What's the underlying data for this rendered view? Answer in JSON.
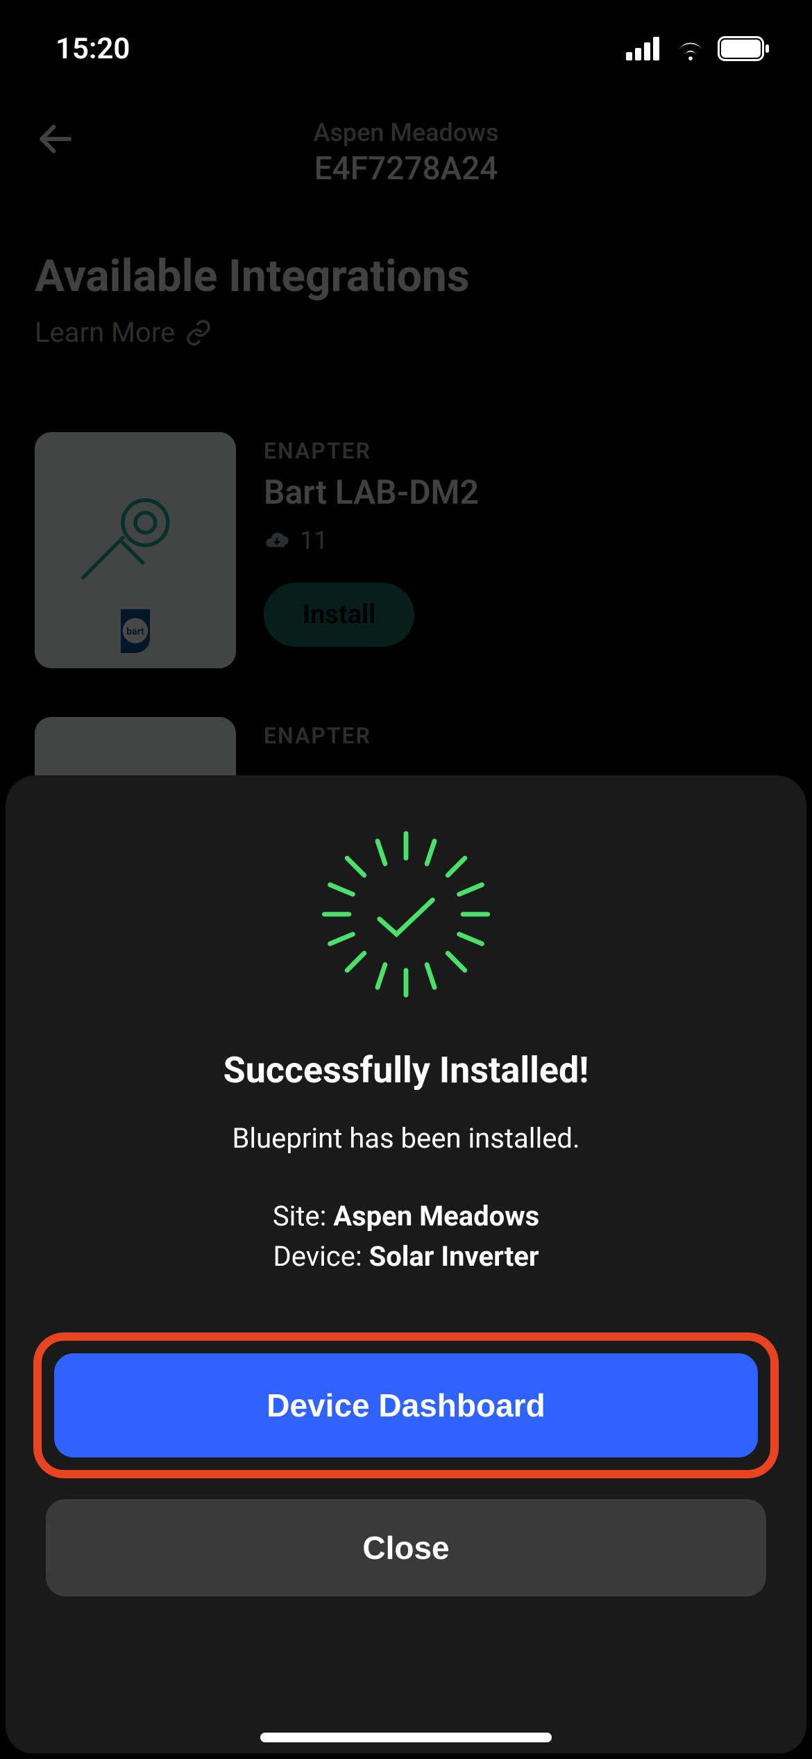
{
  "status": {
    "time": "15:20"
  },
  "header": {
    "site": "Aspen Meadows",
    "id": "E4F7278A24"
  },
  "page": {
    "title": "Available Integrations",
    "learn_more": "Learn More"
  },
  "card1": {
    "vendor": "ENAPTER",
    "title": "Bart LAB-DM2",
    "downloads": "11",
    "install_label": "Install"
  },
  "card2": {
    "vendor": "ENAPTER"
  },
  "modal": {
    "title": "Successfully Installed!",
    "subtitle": "Blueprint  has been installed.",
    "site_label": "Site: ",
    "site_value": "Aspen Meadows",
    "device_label": "Device: ",
    "device_value": "Solar Inverter",
    "primary_btn": "Device Dashboard",
    "secondary_btn": "Close"
  }
}
